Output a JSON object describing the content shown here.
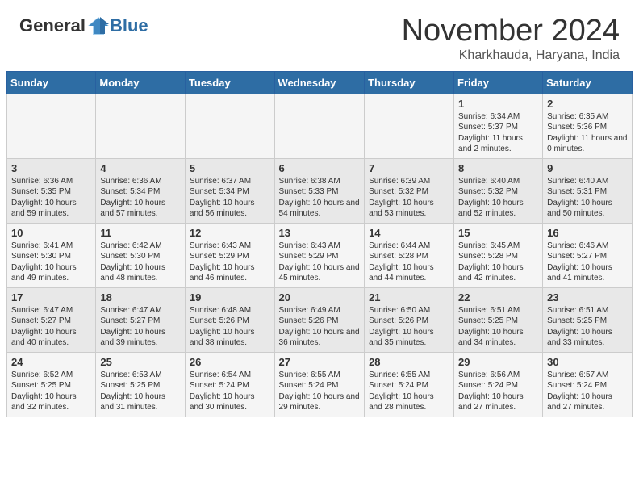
{
  "header": {
    "logo_general": "General",
    "logo_blue": "Blue",
    "month": "November 2024",
    "location": "Kharkhauda, Haryana, India"
  },
  "days_of_week": [
    "Sunday",
    "Monday",
    "Tuesday",
    "Wednesday",
    "Thursday",
    "Friday",
    "Saturday"
  ],
  "weeks": [
    [
      {
        "day": "",
        "info": ""
      },
      {
        "day": "",
        "info": ""
      },
      {
        "day": "",
        "info": ""
      },
      {
        "day": "",
        "info": ""
      },
      {
        "day": "",
        "info": ""
      },
      {
        "day": "1",
        "info": "Sunrise: 6:34 AM\nSunset: 5:37 PM\nDaylight: 11 hours\nand 2 minutes."
      },
      {
        "day": "2",
        "info": "Sunrise: 6:35 AM\nSunset: 5:36 PM\nDaylight: 11 hours\nand 0 minutes."
      }
    ],
    [
      {
        "day": "3",
        "info": "Sunrise: 6:36 AM\nSunset: 5:35 PM\nDaylight: 10 hours\nand 59 minutes."
      },
      {
        "day": "4",
        "info": "Sunrise: 6:36 AM\nSunset: 5:34 PM\nDaylight: 10 hours\nand 57 minutes."
      },
      {
        "day": "5",
        "info": "Sunrise: 6:37 AM\nSunset: 5:34 PM\nDaylight: 10 hours\nand 56 minutes."
      },
      {
        "day": "6",
        "info": "Sunrise: 6:38 AM\nSunset: 5:33 PM\nDaylight: 10 hours\nand 54 minutes."
      },
      {
        "day": "7",
        "info": "Sunrise: 6:39 AM\nSunset: 5:32 PM\nDaylight: 10 hours\nand 53 minutes."
      },
      {
        "day": "8",
        "info": "Sunrise: 6:40 AM\nSunset: 5:32 PM\nDaylight: 10 hours\nand 52 minutes."
      },
      {
        "day": "9",
        "info": "Sunrise: 6:40 AM\nSunset: 5:31 PM\nDaylight: 10 hours\nand 50 minutes."
      }
    ],
    [
      {
        "day": "10",
        "info": "Sunrise: 6:41 AM\nSunset: 5:30 PM\nDaylight: 10 hours\nand 49 minutes."
      },
      {
        "day": "11",
        "info": "Sunrise: 6:42 AM\nSunset: 5:30 PM\nDaylight: 10 hours\nand 48 minutes."
      },
      {
        "day": "12",
        "info": "Sunrise: 6:43 AM\nSunset: 5:29 PM\nDaylight: 10 hours\nand 46 minutes."
      },
      {
        "day": "13",
        "info": "Sunrise: 6:43 AM\nSunset: 5:29 PM\nDaylight: 10 hours\nand 45 minutes."
      },
      {
        "day": "14",
        "info": "Sunrise: 6:44 AM\nSunset: 5:28 PM\nDaylight: 10 hours\nand 44 minutes."
      },
      {
        "day": "15",
        "info": "Sunrise: 6:45 AM\nSunset: 5:28 PM\nDaylight: 10 hours\nand 42 minutes."
      },
      {
        "day": "16",
        "info": "Sunrise: 6:46 AM\nSunset: 5:27 PM\nDaylight: 10 hours\nand 41 minutes."
      }
    ],
    [
      {
        "day": "17",
        "info": "Sunrise: 6:47 AM\nSunset: 5:27 PM\nDaylight: 10 hours\nand 40 minutes."
      },
      {
        "day": "18",
        "info": "Sunrise: 6:47 AM\nSunset: 5:27 PM\nDaylight: 10 hours\nand 39 minutes."
      },
      {
        "day": "19",
        "info": "Sunrise: 6:48 AM\nSunset: 5:26 PM\nDaylight: 10 hours\nand 38 minutes."
      },
      {
        "day": "20",
        "info": "Sunrise: 6:49 AM\nSunset: 5:26 PM\nDaylight: 10 hours\nand 36 minutes."
      },
      {
        "day": "21",
        "info": "Sunrise: 6:50 AM\nSunset: 5:26 PM\nDaylight: 10 hours\nand 35 minutes."
      },
      {
        "day": "22",
        "info": "Sunrise: 6:51 AM\nSunset: 5:25 PM\nDaylight: 10 hours\nand 34 minutes."
      },
      {
        "day": "23",
        "info": "Sunrise: 6:51 AM\nSunset: 5:25 PM\nDaylight: 10 hours\nand 33 minutes."
      }
    ],
    [
      {
        "day": "24",
        "info": "Sunrise: 6:52 AM\nSunset: 5:25 PM\nDaylight: 10 hours\nand 32 minutes."
      },
      {
        "day": "25",
        "info": "Sunrise: 6:53 AM\nSunset: 5:25 PM\nDaylight: 10 hours\nand 31 minutes."
      },
      {
        "day": "26",
        "info": "Sunrise: 6:54 AM\nSunset: 5:24 PM\nDaylight: 10 hours\nand 30 minutes."
      },
      {
        "day": "27",
        "info": "Sunrise: 6:55 AM\nSunset: 5:24 PM\nDaylight: 10 hours\nand 29 minutes."
      },
      {
        "day": "28",
        "info": "Sunrise: 6:55 AM\nSunset: 5:24 PM\nDaylight: 10 hours\nand 28 minutes."
      },
      {
        "day": "29",
        "info": "Sunrise: 6:56 AM\nSunset: 5:24 PM\nDaylight: 10 hours\nand 27 minutes."
      },
      {
        "day": "30",
        "info": "Sunrise: 6:57 AM\nSunset: 5:24 PM\nDaylight: 10 hours\nand 27 minutes."
      }
    ]
  ]
}
